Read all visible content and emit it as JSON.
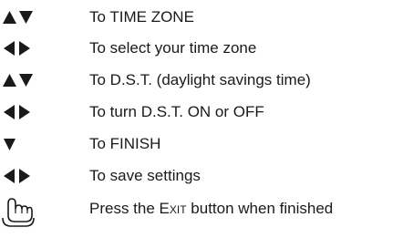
{
  "steps": [
    {
      "icon": "up-down-arrows-icon",
      "text": "To TIME ZONE"
    },
    {
      "icon": "left-right-arrows-icon",
      "text": "To select your time zone"
    },
    {
      "icon": "up-down-arrows-icon",
      "text": "To D.S.T. (daylight savings time)"
    },
    {
      "icon": "left-right-arrows-icon",
      "text": "To turn D.S.T. ON or OFF"
    },
    {
      "icon": "down-arrow-icon",
      "text": "To FINISH"
    },
    {
      "icon": "left-right-arrows-icon",
      "text": "To save settings"
    },
    {
      "icon": "pressing-hand-icon",
      "text_before": "Press the ",
      "text_keyword": "Exit",
      "text_after": " button when finished"
    }
  ],
  "colors": {
    "icon": "#1a1a1a",
    "text": "#1a1a1a"
  }
}
